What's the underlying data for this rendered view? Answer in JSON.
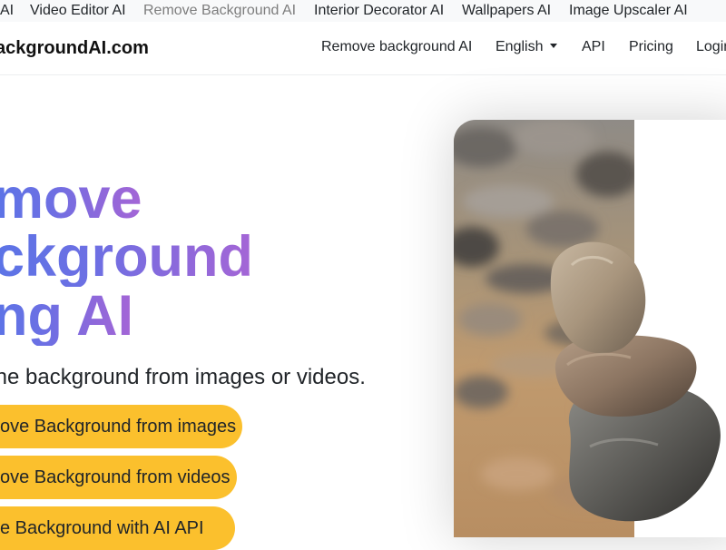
{
  "topbar": {
    "items": [
      {
        "label": "AI"
      },
      {
        "label": "Video Editor AI"
      },
      {
        "label": "Remove Background AI"
      },
      {
        "label": "Interior Decorator AI"
      },
      {
        "label": "Wallpapers AI"
      },
      {
        "label": "Image Upscaler AI"
      }
    ],
    "active_index": 2
  },
  "navbar": {
    "brand": "ackgroundAI.com",
    "links": {
      "remove_bg": "Remove background AI",
      "language": "English",
      "api": "API",
      "pricing": "Pricing",
      "login": "Login"
    }
  },
  "hero": {
    "title_lines": [
      "move",
      "ckground",
      "ng AI"
    ],
    "subtitle": "the background from images or videos.",
    "buttons": [
      {
        "label": "ove Background from images"
      },
      {
        "label": "ove Background from videos"
      },
      {
        "label": "e Background with AI API"
      }
    ]
  },
  "colors": {
    "gradient_start": "#5b74e6",
    "gradient_end": "#a466d6",
    "button_bg": "#fbc02d",
    "topbar_bg": "#f8f9fa",
    "active_link": "#7d7d7d"
  },
  "icons": {
    "language_dropdown": "caret-down-icon"
  }
}
